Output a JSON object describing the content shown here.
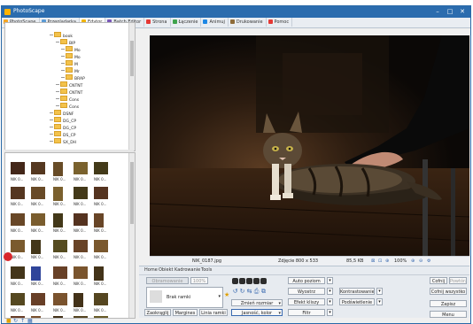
{
  "app": {
    "title": "PhotoScape"
  },
  "tabs": [
    {
      "label": "PhotoScape",
      "color": "#f5a623"
    },
    {
      "label": "Przeglądarka",
      "color": "#5b9bd5"
    },
    {
      "label": "Edytor",
      "color": "#f0b400"
    },
    {
      "label": "Batch Editor",
      "color": "#7a57b8"
    },
    {
      "label": "Strona",
      "color": "#e53935"
    },
    {
      "label": "Łączenie",
      "color": "#3fa34d"
    },
    {
      "label": "Animuj",
      "color": "#1e88e5"
    },
    {
      "label": "Drukowanie",
      "color": "#8e6c3a"
    },
    {
      "label": "Pomoc",
      "color": "#e53935"
    }
  ],
  "tree": {
    "items": [
      "book",
      "BIP",
      "Mo",
      "Mo",
      "M",
      "Mr",
      "BRAP",
      "CNTNT",
      "CNTNT",
      "Cons",
      "Cons",
      "DSNF",
      "DG_CP",
      "DG_CP",
      "DS_CP",
      "SX_DH"
    ]
  },
  "thumbnails": {
    "labels": [
      "NIK 0...",
      "NIK 0...",
      "NIK 0...",
      "NIK 0...",
      "NIK 0...",
      "NIK 0...",
      "NIK 0...",
      "NIK 0...",
      "NIK 0...",
      "NIK 0...",
      "NIK 0...",
      "NIK 0...",
      "NIK 0...",
      "NIK 0...",
      "NIK 0...",
      "NIK 0...",
      "NIK 0...",
      "NIK 0...",
      "NIK 0...",
      "NIK 0...",
      "NIK 0...",
      "NIK 0...",
      "NIK 0...",
      "NIK 0...",
      "NIK 0...",
      "NIK 0...",
      "NIK 0...",
      "NIK 0...",
      "NIK 0...",
      "NIK 0...",
      "NIK 0...",
      "NIK 0...",
      "NIK 0...",
      "NIK 0...",
      "NIK 0...",
      "NIK 0..."
    ]
  },
  "status": {
    "filename": "NIK_0187.jpg",
    "size": "Zdjęcie 800 x 533",
    "filesize": "85,5 KB",
    "zoom": "100%"
  },
  "editor": {
    "tabs": [
      "Home",
      "Obiekt",
      "Kadrowanie",
      "Tools"
    ],
    "frame_label": "Obramowanie",
    "frame_value": "100%",
    "no_frame": "Brak ramki",
    "btn_zaokraglij": "Zaokrąglij",
    "btn_margines": "Margines",
    "btn_linia_ramki": "Linia ramki",
    "btn_auto_poziom": "Auto poziom",
    "btn_wyostrz": "Wyostrz",
    "btn_efekt_kliszy": "Efekt kliszy",
    "btn_filtr": "Filtr",
    "btn_zmien_rozmiar": "Zmień rozmiar",
    "btn_jasnosc_kolor": "Jasność, kolor",
    "btn_kontrastowanie": "Kontrastowanie",
    "btn_podswietlenie": "Podświetlenie",
    "btn_cofnij": "Cofnij",
    "btn_powtorz": "Powtórz",
    "btn_cofnij_wszystko": "Cofnij wszystko",
    "btn_zapisz": "Zapisz",
    "btn_menu": "Menu"
  }
}
